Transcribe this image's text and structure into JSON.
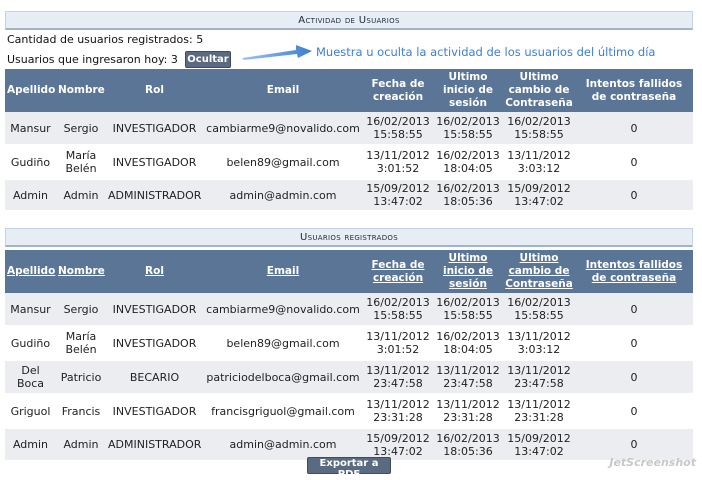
{
  "activity": {
    "title": "Actividad de Usuarios",
    "registered_count_label": "Cantidad de usuarios registrados: 5",
    "today_label": "Usuarios que ingresaron hoy: 3",
    "toggle_button": "Ocultar",
    "hint": "Muestra u oculta la actividad de los usuarios del último día",
    "headers": [
      "Apellido",
      "Nombre",
      "Rol",
      "Email",
      "Fecha de creación",
      "Ultimo inicio de sesión",
      "Ultimo cambio de Contraseña",
      "Intentos fallidos de contraseña"
    ],
    "rows": [
      [
        "Mansur",
        "Sergio",
        "INVESTIGADOR",
        "cambiarme9@novalido.com",
        "16/02/2013 15:58:55",
        "16/02/2013 15:58:55",
        "16/02/2013 15:58:55",
        "0"
      ],
      [
        "Gudiño",
        "María Belén",
        "INVESTIGADOR",
        "belen89@gmail.com",
        "13/11/2012 3:01:52",
        "16/02/2013 18:04:05",
        "13/11/2012 3:03:12",
        "0"
      ],
      [
        "Admin",
        "Admin",
        "ADMINISTRADOR",
        "admin@admin.com",
        "15/09/2012 13:47:02",
        "16/02/2013 18:05:36",
        "15/09/2012 13:47:02",
        "0"
      ]
    ]
  },
  "users": {
    "title": "Usuarios registrados",
    "headers": [
      "Apellido",
      "Nombre",
      "Rol",
      "Email",
      "Fecha de creación",
      "Ultimo inicio de sesión",
      "Ultimo cambio de Contraseña",
      "Intentos fallidos de contraseña"
    ],
    "rows": [
      [
        "Mansur",
        "Sergio",
        "INVESTIGADOR",
        "cambiarme9@novalido.com",
        "16/02/2013 15:58:55",
        "16/02/2013 15:58:55",
        "16/02/2013 15:58:55",
        "0"
      ],
      [
        "Gudiño",
        "María Belén",
        "INVESTIGADOR",
        "belen89@gmail.com",
        "13/11/2012 3:01:52",
        "16/02/2013 18:04:05",
        "13/11/2012 3:03:12",
        "0"
      ],
      [
        "Del Boca",
        "Patricio",
        "BECARIO",
        "patriciodelboca@gmail.com",
        "13/11/2012 23:47:58",
        "13/11/2012 23:47:58",
        "13/11/2012 23:47:58",
        "0"
      ],
      [
        "Griguol",
        "Francis",
        "INVESTIGADOR",
        "francisgriguol@gmail.com",
        "13/11/2012 23:31:28",
        "13/11/2012 23:31:28",
        "13/11/2012 23:31:28",
        "0"
      ],
      [
        "Admin",
        "Admin",
        "ADMINISTRADOR",
        "admin@admin.com",
        "15/09/2012 13:47:02",
        "16/02/2013 18:05:36",
        "15/09/2012 13:47:02",
        "0"
      ]
    ],
    "export_button": "Exportar a PDF"
  },
  "watermark": "JetScreenshot",
  "colors": {
    "header_bg": "#5b7597",
    "accent_blue": "#3c7fd0",
    "button_bg": "#5a6a80"
  }
}
